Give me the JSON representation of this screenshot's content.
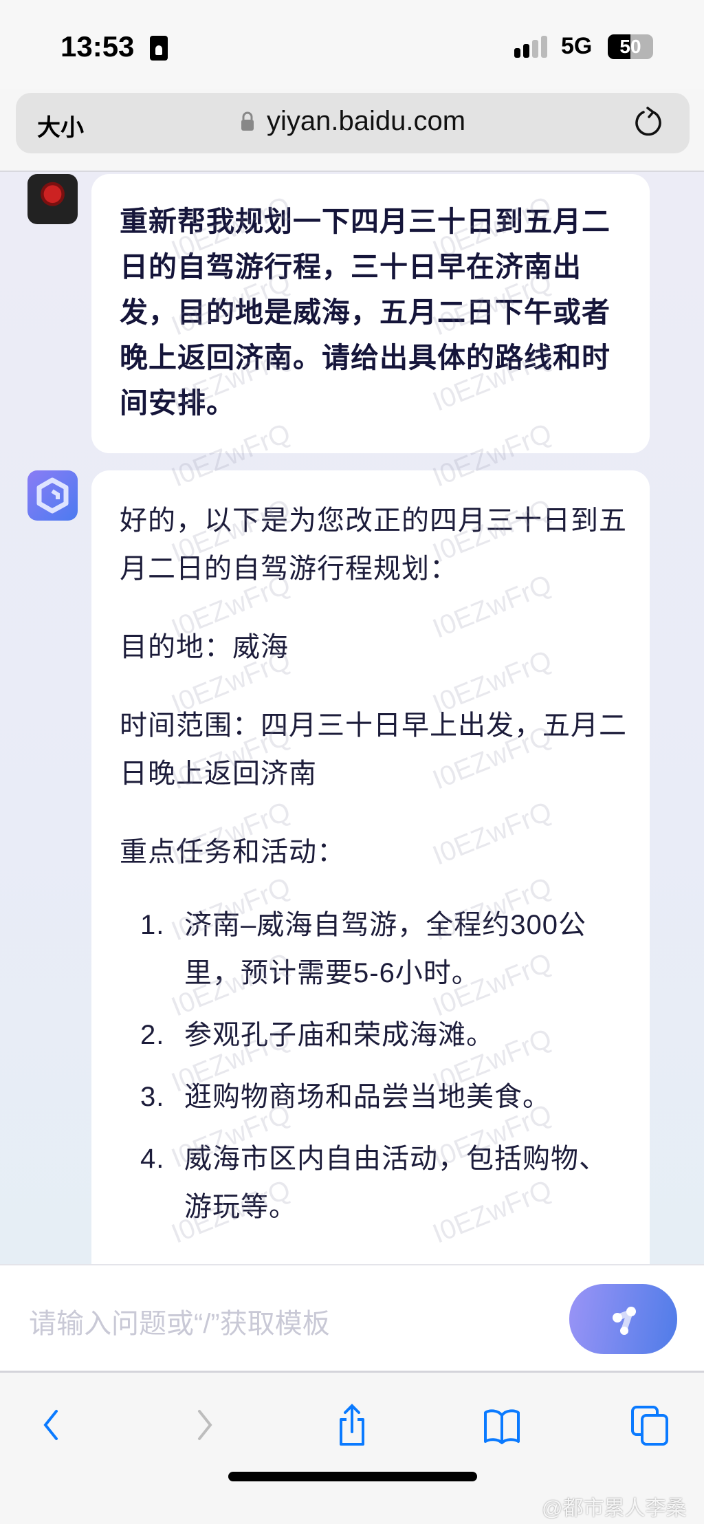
{
  "status_bar": {
    "time": "13:53",
    "network": "5G",
    "battery": "50",
    "battery_level_percent": 50
  },
  "browser": {
    "text_size_label": "大小",
    "url": "yiyan.baidu.com"
  },
  "chat": {
    "user_message": "重新帮我规划一下四月三十日到五月二日的自驾游行程，三十日早在济南出发，目的地是威海，五月二日下午或者晚上返回济南。请给出具体的路线和时间安排。",
    "bot_paragraphs": [
      "好的，以下是为您改正的四月三十日到五月二日的自驾游行程规划：",
      "目的地：威海",
      "时间范围：四月三十日早上出发，五月二日晚上返回济南",
      "重点任务和活动："
    ],
    "bot_list": [
      {
        "num": "1.",
        "text": "济南–威海自驾游，全程约300公里，预计需要5-6小时。"
      },
      {
        "num": "2.",
        "text": "参观孔子庙和荣成海滩。"
      },
      {
        "num": "3.",
        "text": "逛购物商场和品尝当地美食。"
      },
      {
        "num": "4.",
        "text": "威海市区内自由活动，包括购物、游玩等。"
      }
    ],
    "watermark": "I0EZwFrQ"
  },
  "input": {
    "placeholder": "请输入问题或“/”获取模板"
  },
  "credit": "@都市累人李桑",
  "colors": {
    "accent": "#0a7aff",
    "send_gradient_start": "#9a94f6",
    "send_gradient_end": "#4f7ce8"
  }
}
